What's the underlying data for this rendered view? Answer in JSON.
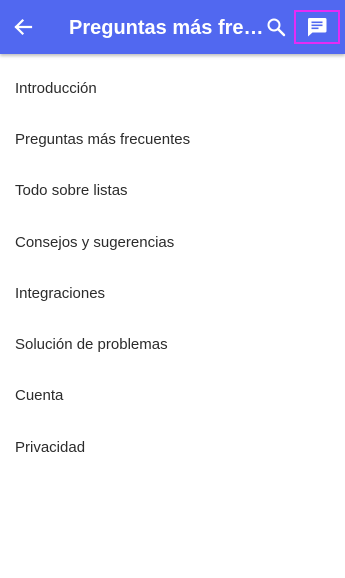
{
  "header": {
    "title": "Preguntas más frecuentes",
    "accent_color": "#5168f0",
    "back_icon": "arrow-left-icon",
    "search_icon": "search-icon",
    "feedback_icon": "chat-message-icon"
  },
  "menu": {
    "items": [
      {
        "label": "Introducción"
      },
      {
        "label": "Preguntas más frecuentes"
      },
      {
        "label": "Todo sobre listas"
      },
      {
        "label": "Consejos y sugerencias"
      },
      {
        "label": "Integraciones"
      },
      {
        "label": "Solución de problemas"
      },
      {
        "label": "Cuenta"
      },
      {
        "label": "Privacidad"
      }
    ]
  }
}
